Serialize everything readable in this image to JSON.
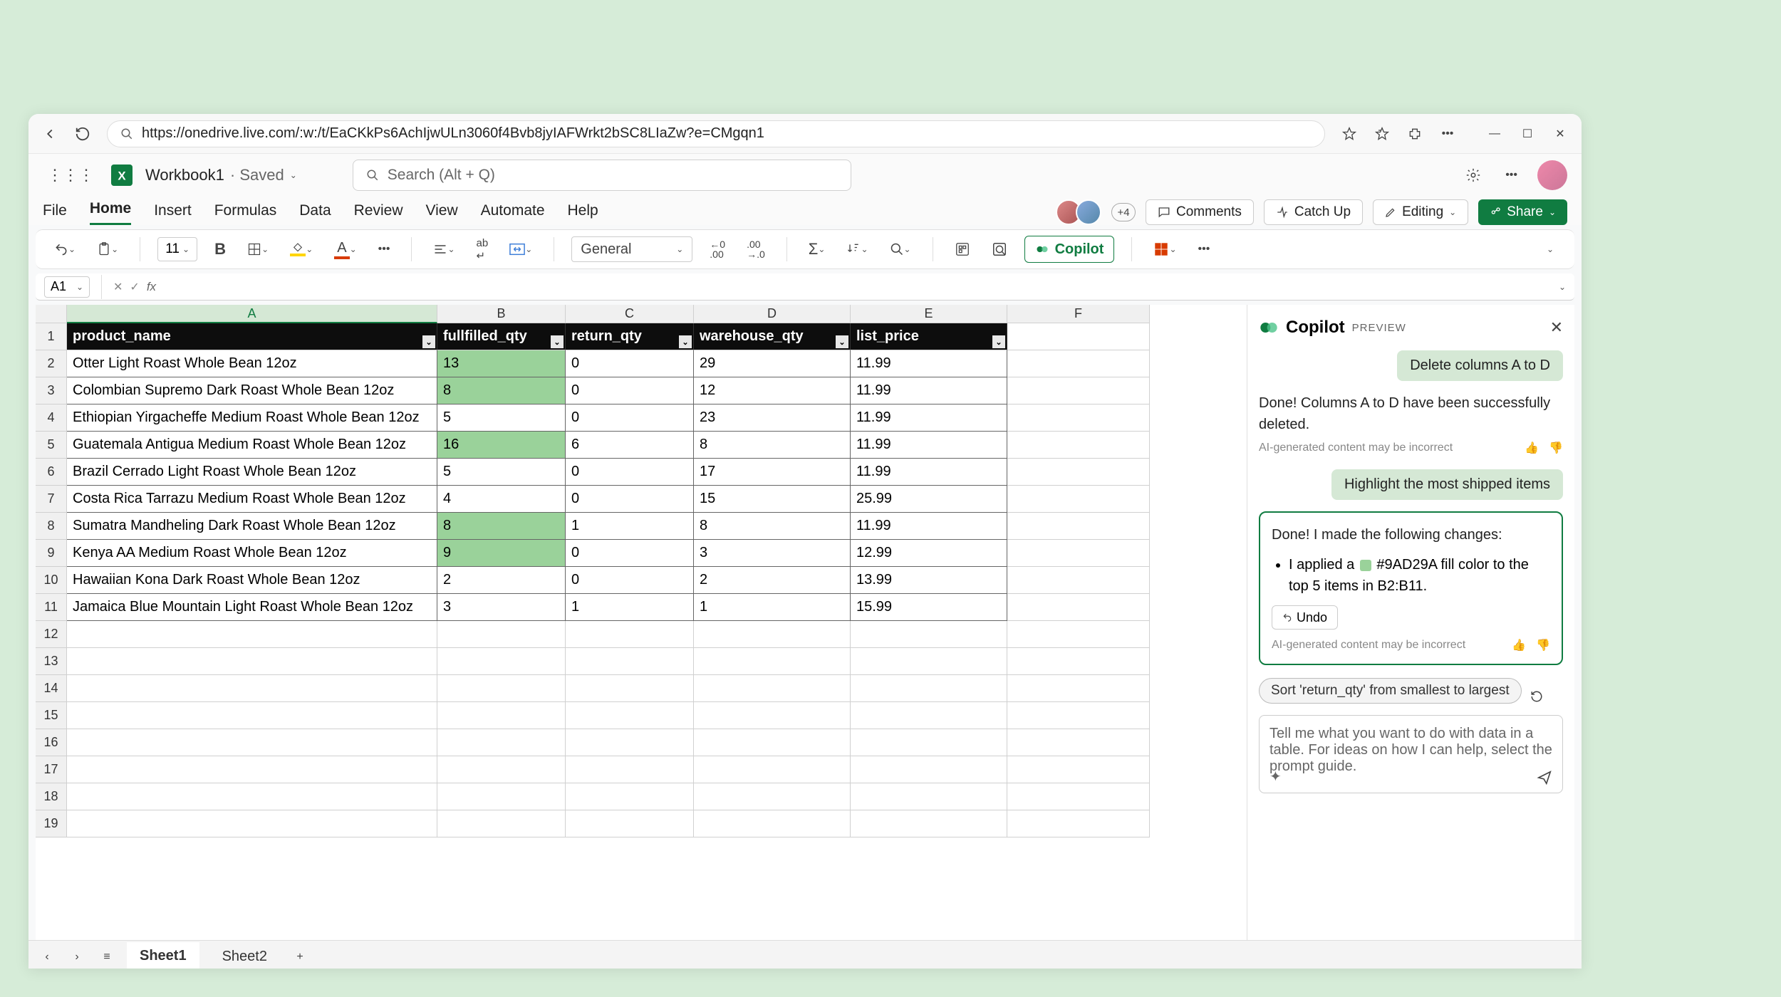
{
  "browser": {
    "url": "https://onedrive.live.com/:w:/t/EaCKkPs6AchIjwULn3060f4Bvb8jyIAFWrkt2bSC8LIaZw?e=CMgqn1",
    "window_minimize": "—",
    "window_maximize": "☐",
    "window_close": "✕"
  },
  "app": {
    "doc_name": "Workbook1",
    "saved": "· Saved",
    "search_placeholder": "Search (Alt + Q)",
    "presence_extra": "+4"
  },
  "ribbon": {
    "tabs": [
      "File",
      "Home",
      "Insert",
      "Formulas",
      "Data",
      "Review",
      "View",
      "Automate",
      "Help"
    ],
    "comments": "Comments",
    "catchup": "Catch Up",
    "editing": "Editing",
    "share": "Share"
  },
  "toolbar": {
    "font_size": "11",
    "number_format": "General",
    "copilot": "Copilot"
  },
  "formula": {
    "ref": "A1"
  },
  "grid": {
    "columns": [
      "A",
      "B",
      "C",
      "D",
      "E",
      "F"
    ],
    "headers": [
      "product_name",
      "fullfilled_qty",
      "return_qty",
      "warehouse_qty",
      "list_price"
    ],
    "widths": [
      520,
      180,
      180,
      220,
      220,
      200
    ],
    "rows": [
      {
        "n": 1
      },
      {
        "n": 2,
        "a": "Otter Light Roast Whole Bean 12oz",
        "b": "13",
        "c": "0",
        "d": "29",
        "e": "11.99",
        "hl": true
      },
      {
        "n": 3,
        "a": "Colombian Supremo Dark Roast Whole Bean 12oz",
        "b": "8",
        "c": "0",
        "d": "12",
        "e": "11.99",
        "hl": true
      },
      {
        "n": 4,
        "a": "Ethiopian Yirgacheffe Medium Roast Whole Bean 12oz",
        "b": "5",
        "c": "0",
        "d": "23",
        "e": "11.99"
      },
      {
        "n": 5,
        "a": "Guatemala Antigua Medium Roast Whole Bean 12oz",
        "b": "16",
        "c": "6",
        "d": "8",
        "e": "11.99",
        "hl": true
      },
      {
        "n": 6,
        "a": "Brazil Cerrado Light Roast Whole Bean 12oz",
        "b": "5",
        "c": "0",
        "d": "17",
        "e": "11.99"
      },
      {
        "n": 7,
        "a": "Costa Rica Tarrazu Medium Roast Whole Bean 12oz",
        "b": "4",
        "c": "0",
        "d": "15",
        "e": "25.99"
      },
      {
        "n": 8,
        "a": "Sumatra Mandheling Dark Roast Whole Bean 12oz",
        "b": "8",
        "c": "1",
        "d": "8",
        "e": "11.99",
        "hl": true
      },
      {
        "n": 9,
        "a": "Kenya AA Medium Roast Whole Bean 12oz",
        "b": "9",
        "c": "0",
        "d": "3",
        "e": "12.99",
        "hl": true
      },
      {
        "n": 10,
        "a": "Hawaiian Kona Dark Roast Whole Bean 12oz",
        "b": "2",
        "c": "0",
        "d": "2",
        "e": "13.99"
      },
      {
        "n": 11,
        "a": "Jamaica Blue Mountain Light Roast Whole Bean 12oz",
        "b": "3",
        "c": "1",
        "d": "1",
        "e": "15.99"
      },
      {
        "n": 12
      },
      {
        "n": 13
      },
      {
        "n": 14
      },
      {
        "n": 15
      },
      {
        "n": 16
      },
      {
        "n": 17
      },
      {
        "n": 18
      },
      {
        "n": 19
      }
    ]
  },
  "sheets": [
    "Sheet1",
    "Sheet2"
  ],
  "copilot": {
    "title": "Copilot",
    "preview": "PREVIEW",
    "user1": "Delete columns A to D",
    "resp1": "Done! Columns A to D have been successfully deleted.",
    "disclaimer": "AI-generated content may be incorrect",
    "user2": "Highlight the most shipped items",
    "resp2_lead": "Done! I made the following changes:",
    "resp2_item_pre": "I applied a ",
    "resp2_item_color": "#9AD29A",
    "resp2_item_post": " fill color to the top 5 items in B2:B11.",
    "undo": "Undo",
    "suggest": "Sort 'return_qty' from smallest to largest",
    "input_placeholder": "Tell me what you want to do with data in a table. For ideas on how I can help, select the prompt guide."
  }
}
